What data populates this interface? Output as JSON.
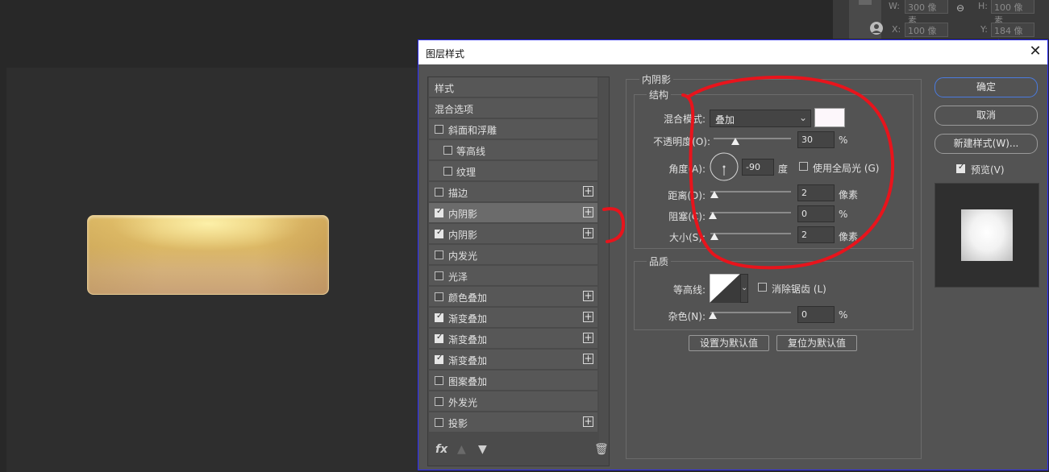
{
  "props": {
    "w_label": "W:",
    "w_value": "300 像素",
    "h_label": "H:",
    "h_value": "100 像素",
    "x_label": "X:",
    "x_value": "100 像素",
    "y_label": "Y:",
    "y_value": "184 像素"
  },
  "dialog": {
    "title": "图层样式",
    "close": "✕",
    "style_list": {
      "items": [
        {
          "label": "样式"
        },
        {
          "label": "混合选项"
        },
        {
          "label": "斜面和浮雕"
        },
        {
          "label": "等高线"
        },
        {
          "label": "纹理"
        },
        {
          "label": "描边"
        },
        {
          "label": "内阴影"
        },
        {
          "label": "内阴影"
        },
        {
          "label": "内发光"
        },
        {
          "label": "光泽"
        },
        {
          "label": "颜色叠加"
        },
        {
          "label": "渐变叠加"
        },
        {
          "label": "渐变叠加"
        },
        {
          "label": "渐变叠加"
        },
        {
          "label": "图案叠加"
        },
        {
          "label": "外发光"
        },
        {
          "label": "投影"
        }
      ],
      "footer": {
        "fx": "fx",
        "up": "▲",
        "down": "▼",
        "trash": "🗑"
      }
    },
    "inner_shadow": {
      "group_title": "内阴影",
      "structure_title": "结构",
      "blend_mode_label": "混合模式:",
      "blend_mode_value": "叠加",
      "opacity_label": "不透明度(O):",
      "opacity_value": "30",
      "opacity_unit": "%",
      "angle_label": "角度(A):",
      "angle_value": "-90",
      "angle_unit": "度",
      "global_light_label": "使用全局光 (G)",
      "distance_label": "距离(D):",
      "distance_value": "2",
      "distance_unit": "像素",
      "choke_label": "阻塞(C):",
      "choke_value": "0",
      "choke_unit": "%",
      "size_label": "大小(S):",
      "size_value": "2",
      "size_unit": "像素",
      "quality_title": "品质",
      "contour_label": "等高线:",
      "antialias_label": "消除锯齿 (L)",
      "noise_label": "杂色(N):",
      "noise_value": "0",
      "noise_unit": "%",
      "set_default": "设置为默认值",
      "reset_default": "复位为默认值"
    },
    "buttons": {
      "ok": "确定",
      "cancel": "取消",
      "new_style": "新建样式(W)...",
      "preview_label": "预览(V)"
    }
  }
}
